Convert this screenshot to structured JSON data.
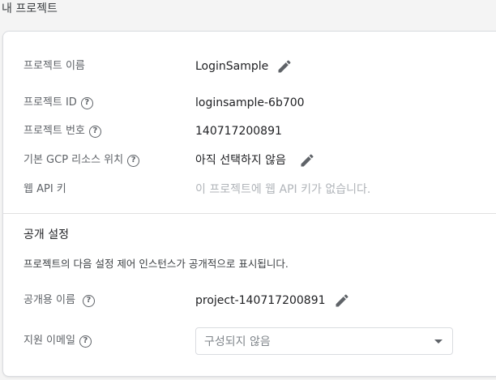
{
  "header": {
    "title": "내 프로젝트"
  },
  "project": {
    "name_label": "프로젝트 이름",
    "name_value": "LoginSample",
    "id_label": "프로젝트 ID",
    "id_value": "loginsample-6b700",
    "number_label": "프로젝트 번호",
    "number_value": "140717200891",
    "gcp_label": "기본 GCP 리소스 위치",
    "gcp_value": "아직 선택하지 않음",
    "webapi_label": "웹 API 키",
    "webapi_value": "이 프로젝트에 웹 API 키가 없습니다."
  },
  "public_settings": {
    "title": "공개 설정",
    "description": "프로젝트의 다음 설정 제어 인스턴스가 공개적으로 표시됩니다.",
    "public_name_label": "공개용 이름",
    "public_name_value": "project-140717200891",
    "support_email_label": "지원 이메일",
    "support_email_value": "구성되지 않음"
  },
  "icons": {
    "help": "help-circle-icon",
    "edit": "pencil-icon",
    "dropdown": "caret-down-icon"
  },
  "colors": {
    "label": "#5f6368",
    "muted": "#b0b4b9",
    "border": "#dadce0"
  }
}
